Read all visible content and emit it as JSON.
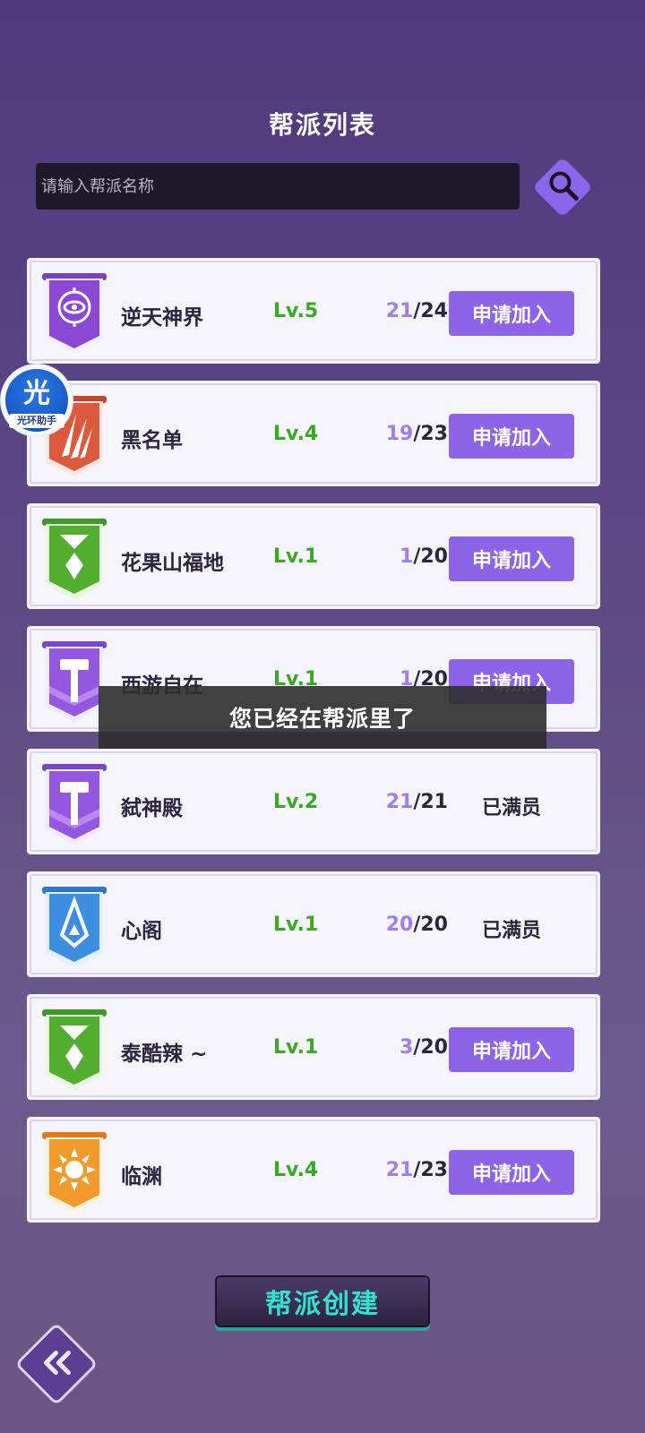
{
  "header": {
    "title": "帮派列表"
  },
  "search": {
    "placeholder": "请输入帮派名称"
  },
  "guilds": [
    {
      "name": "逆天神界",
      "level": "Lv.5",
      "current": "21",
      "max": "/24",
      "action": "申请加入",
      "emblem": "purple-eye-emblem-icon"
    },
    {
      "name": "黑名单",
      "level": "Lv.4",
      "current": "19",
      "max": "/23",
      "action": "申请加入",
      "emblem": "red-claw-emblem-icon"
    },
    {
      "name": "花果山福地",
      "level": "Lv.1",
      "current": "1",
      "max": "/20",
      "action": "申请加入",
      "emblem": "green-diamond-emblem-icon"
    },
    {
      "name": "西游自在",
      "level": "Lv.1",
      "current": "1",
      "max": "/20",
      "action": "申请加入",
      "emblem": "purple-hammer-emblem-icon"
    },
    {
      "name": "弑神殿",
      "level": "Lv.2",
      "current": "21",
      "max": "/21",
      "action": "已满员",
      "emblem": "purple-hammer-emblem-icon"
    },
    {
      "name": "心阁",
      "level": "Lv.1",
      "current": "20",
      "max": "/20",
      "action": "已满员",
      "emblem": "blue-crystal-emblem-icon"
    },
    {
      "name": "泰酷辣 ~",
      "level": "Lv.1",
      "current": "3",
      "max": "/20",
      "action": "申请加入",
      "emblem": "green-diamond-emblem-icon"
    },
    {
      "name": "临渊",
      "level": "Lv.4",
      "current": "21",
      "max": "/23",
      "action": "申请加入",
      "emblem": "orange-sun-emblem-icon"
    }
  ],
  "toast": {
    "message": "您已经在帮派里了"
  },
  "floating_assistant": {
    "glyph": "光",
    "caption": "光环助手"
  },
  "footer": {
    "create_label": "帮派创建"
  },
  "colors": {
    "accent": "#8d63e8",
    "level": "#3aa827",
    "count_current": "#a27df0"
  }
}
